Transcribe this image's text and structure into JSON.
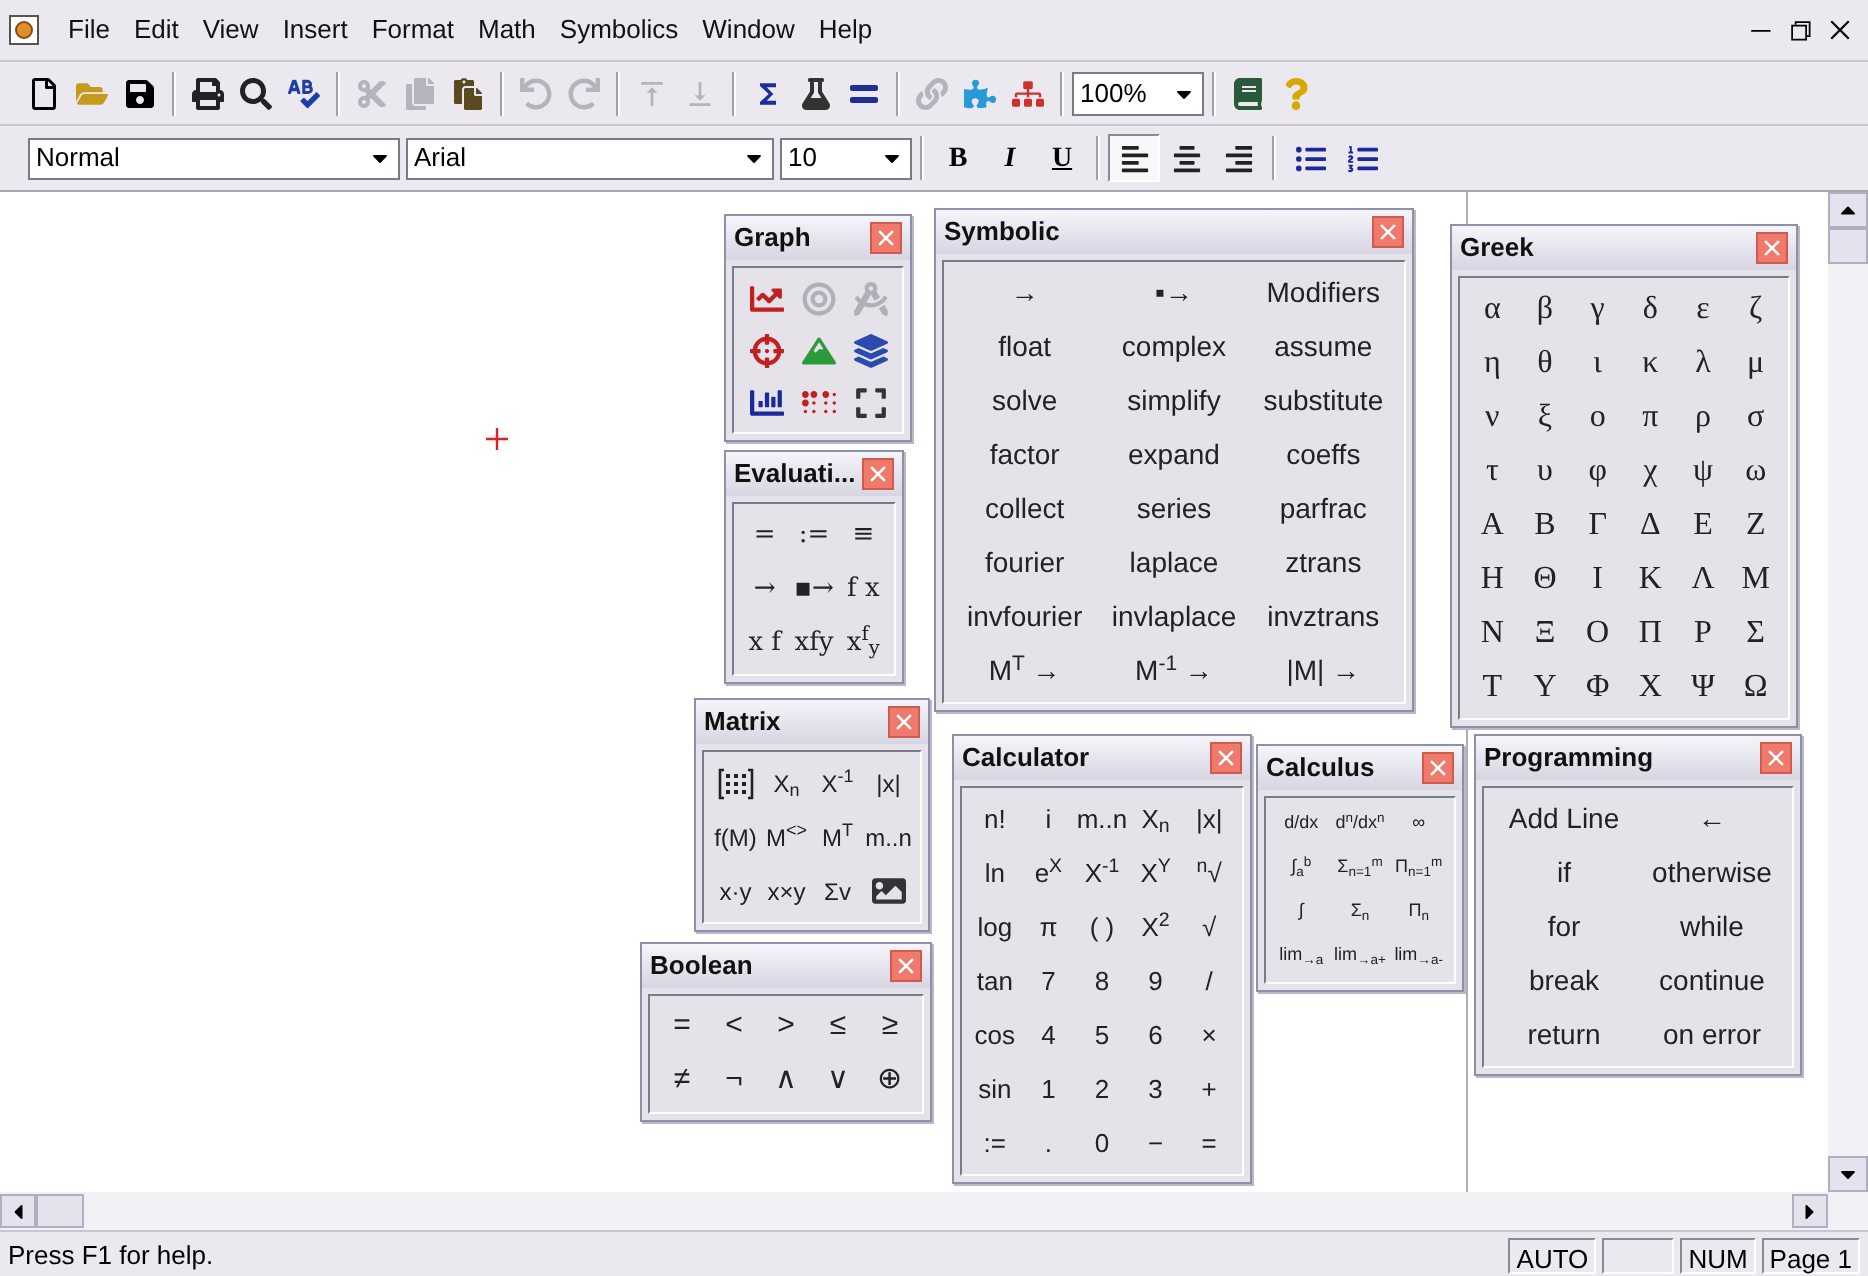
{
  "menu": [
    "File",
    "Edit",
    "View",
    "Insert",
    "Format",
    "Math",
    "Symbolics",
    "Window",
    "Help"
  ],
  "toolbar": {
    "groups": [
      [
        {
          "disabled": false
        },
        {
          "disabled": false
        },
        {
          "disabled": false
        }
      ],
      [
        {
          "disabled": false
        },
        {
          "disabled": false
        },
        {
          "disabled": false
        }
      ],
      [
        {
          "disabled": true
        },
        {
          "disabled": true
        },
        {
          "disabled": false
        }
      ],
      [
        {
          "disabled": true
        },
        {
          "disabled": true
        }
      ],
      [
        {
          "disabled": true
        },
        {
          "disabled": true
        }
      ],
      [
        {
          "disabled": false
        },
        {
          "disabled": false
        },
        {
          "disabled": false
        }
      ],
      [
        {
          "disabled": true
        },
        {
          "disabled": false
        },
        {
          "disabled": false
        }
      ]
    ],
    "zoom": "100%",
    "groups_after": [
      [
        {
          "disabled": false
        },
        {
          "disabled": false
        }
      ]
    ]
  },
  "format_bar": {
    "style": "Normal",
    "font": "Arial",
    "size": "10",
    "text_buttons": [
      "B",
      "I",
      "U"
    ],
    "align": [
      {
        "selected": true
      },
      {
        "selected": false
      },
      {
        "selected": false
      }
    ]
  },
  "palettes": [
    {
      "title": "Graph",
      "kind": "icons",
      "items": [
        {
          "disabled": false
        },
        {
          "disabled": true
        },
        {
          "disabled": true
        },
        {
          "disabled": false
        },
        {
          "disabled": false
        },
        {
          "disabled": false
        },
        {
          "disabled": false
        },
        {
          "disabled": false
        },
        {
          "disabled": false
        }
      ]
    },
    {
      "title": "Evaluati...",
      "kind": "text",
      "items": [
        "=",
        ":=",
        "≡",
        "→",
        "▪→",
        "f x",
        "x f",
        "xfy",
        "x$^{f}$$_{y}$"
      ]
    },
    {
      "title": "Symbolic",
      "kind": "text",
      "items": [
        "→",
        "▪→",
        "Modifiers",
        "float",
        "complex",
        "assume",
        "solve",
        "simplify",
        "substitute",
        "factor",
        "expand",
        "coeffs",
        "collect",
        "series",
        "parfrac",
        "fourier",
        "laplace",
        "ztrans",
        "invfourier",
        "invlaplace",
        "invztrans",
        "M$^{T}$ →",
        "M$^{-1}$ →",
        "|M| →"
      ]
    },
    {
      "title": "Greek",
      "kind": "text",
      "items": [
        "α",
        "β",
        "γ",
        "δ",
        "ε",
        "ζ",
        "η",
        "θ",
        "ι",
        "κ",
        "λ",
        "μ",
        "ν",
        "ξ",
        "ο",
        "π",
        "ρ",
        "σ",
        "τ",
        "υ",
        "φ",
        "χ",
        "ψ",
        "ω",
        "Α",
        "Β",
        "Γ",
        "Δ",
        "Ε",
        "Ζ",
        "Η",
        "Θ",
        "Ι",
        "Κ",
        "Λ",
        "Μ",
        "Ν",
        "Ξ",
        "Ο",
        "Π",
        "Ρ",
        "Σ",
        "Τ",
        "Υ",
        "Φ",
        "Χ",
        "Ψ",
        "Ω"
      ]
    },
    {
      "title": "Matrix",
      "kind": "mixed",
      "items": [
        {
          "kind": "icon"
        },
        {
          "kind": "text",
          "text": "X$_{n}$"
        },
        {
          "kind": "text",
          "text": "X$^{-1}$"
        },
        {
          "kind": "text",
          "text": "|x|"
        },
        {
          "kind": "text",
          "text": "f(M)"
        },
        {
          "kind": "text",
          "text": "M$^{<>}$"
        },
        {
          "kind": "text",
          "text": "M$^{T}$"
        },
        {
          "kind": "text",
          "text": "m..n"
        },
        {
          "kind": "text",
          "text": "x·y"
        },
        {
          "kind": "text",
          "text": "x×y"
        },
        {
          "kind": "text",
          "text": "Σv"
        },
        {
          "kind": "picture-icon"
        }
      ]
    },
    {
      "title": "Boolean",
      "kind": "text",
      "items": [
        "=",
        "<",
        ">",
        "≤",
        "≥",
        "≠",
        "¬",
        "∧",
        "∨",
        "⊕"
      ]
    },
    {
      "title": "Calculator",
      "kind": "text",
      "items": [
        "n!",
        "i",
        "m..n",
        "X$_{n}$",
        "|x|",
        "ln",
        "e$^{X}$",
        "X$^{-1}$",
        "X$^{Y}$",
        "$^{n}$√",
        "log",
        "π",
        "( )",
        "X$^{2}$",
        "√",
        "tan",
        "7",
        "8",
        "9",
        "/",
        "cos",
        "4",
        "5",
        "6",
        "×",
        "sin",
        "1",
        "2",
        "3",
        "+",
        ":=",
        ".",
        "0",
        "−",
        "="
      ]
    },
    {
      "title": "Calculus",
      "kind": "text",
      "items": [
        "d/dx",
        "d$^{n}$/dx$^{n}$",
        "∞",
        "∫$_{a}$$^{b}$",
        "Σ$_{n=1}$$^{m}$",
        "Π$_{n=1}$$^{m}$",
        "∫",
        "Σ$_{n}$",
        "Π$_{n}$",
        "lim$_{→a}$",
        "lim$_{→a+}$",
        "lim$_{→a-}$"
      ]
    },
    {
      "title": "Programming",
      "kind": "text",
      "items": [
        "Add Line",
        "←",
        "if",
        "otherwise",
        "for",
        "while",
        "break",
        "continue",
        "return",
        "on error"
      ]
    }
  ],
  "status_bar": {
    "message": "Press F1 for help.",
    "panels": [
      {
        "kind": "text",
        "text": "AUTO"
      },
      {
        "kind": "blank"
      },
      {
        "kind": "text",
        "text": "NUM"
      },
      {
        "kind": "text",
        "text": "Page 1"
      }
    ]
  }
}
